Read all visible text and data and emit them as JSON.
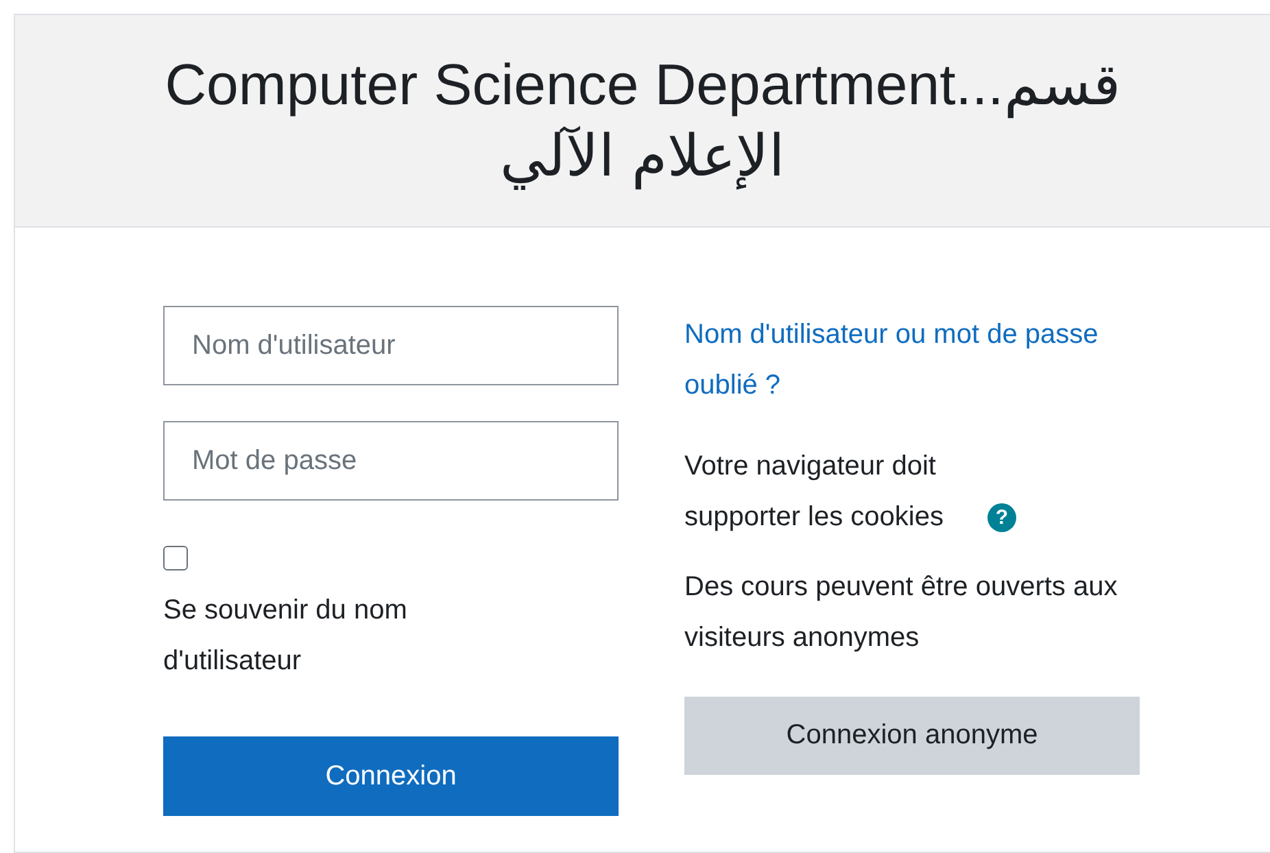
{
  "header": {
    "title": "Computer Science Department...قسم الإعلام الآلي"
  },
  "login": {
    "username": {
      "placeholder": "Nom d'utilisateur"
    },
    "password": {
      "placeholder": "Mot de passe"
    },
    "remember": {
      "label": "Se souvenir du nom d'utilisateur",
      "checked": false
    },
    "submit": "Connexion"
  },
  "info": {
    "forgot_link": "Nom d'utilisateur ou mot de passe oublié ?",
    "cookies_text": "Votre navigateur doit supporter les cookies",
    "help_icon": "?",
    "guest_text": "Des cours peuvent être ouverts aux visiteurs anonymes",
    "guest_button": "Connexion anonyme"
  }
}
